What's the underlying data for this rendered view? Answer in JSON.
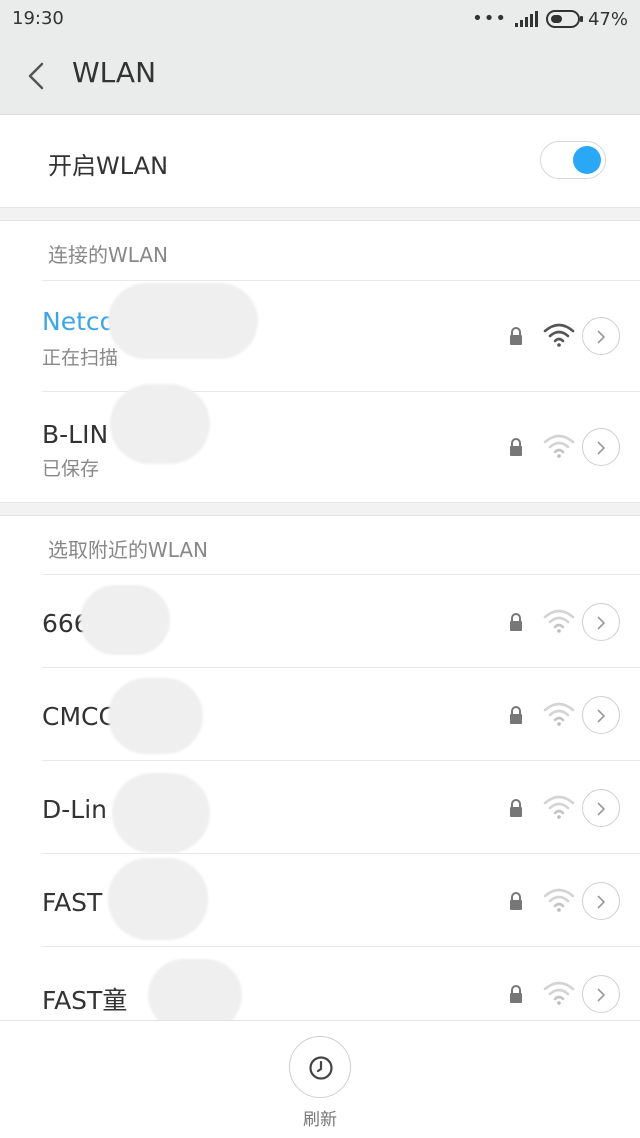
{
  "status_bar": {
    "time": "19:30",
    "battery": "47%",
    "battery_level": 0.47,
    "menu_dots": "•••"
  },
  "header": {
    "title": "WLAN"
  },
  "wlan_toggle": {
    "label": "开启WLAN",
    "on": true
  },
  "connected_section": {
    "title": "连接的WLAN",
    "networks": [
      {
        "name": "Netco",
        "status": "正在扫描"
      },
      {
        "name": "B-LIN 310",
        "status": "已保存"
      }
    ]
  },
  "nearby_section": {
    "title": "选取附近的WLAN",
    "networks": [
      {
        "name": "666"
      },
      {
        "name": "CMCC m"
      },
      {
        "name": "D-Lin 816"
      },
      {
        "name": "FAST 04"
      },
      {
        "name": "FAST童"
      }
    ]
  },
  "bottom": {
    "refresh_label": "刷新"
  },
  "colors": {
    "accent": "#2aa7f5",
    "header_bg": "#eaebeb",
    "active_network": "#3ba6e6"
  }
}
